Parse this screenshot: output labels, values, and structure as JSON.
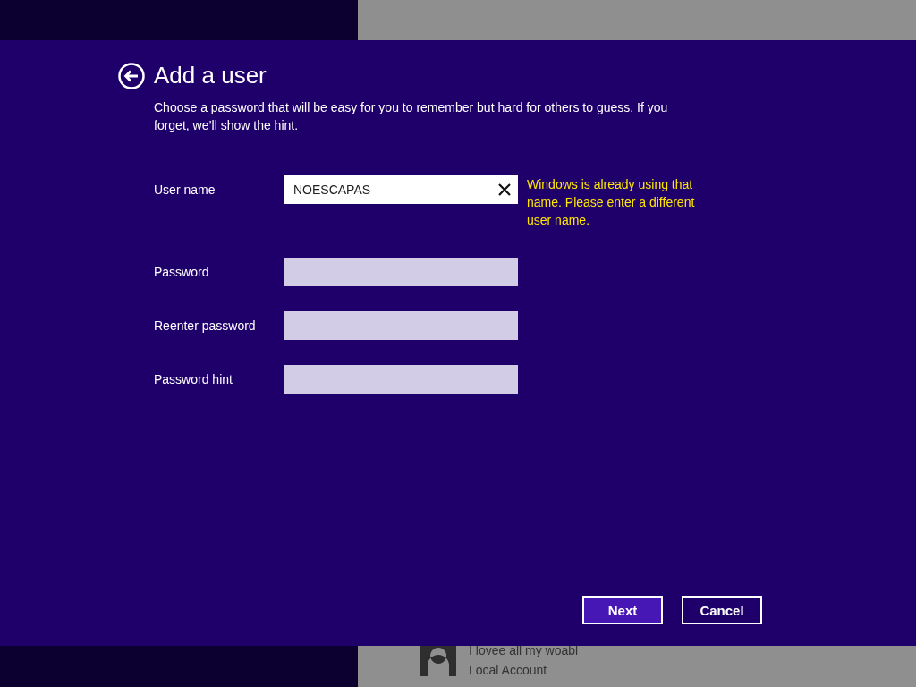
{
  "dialog": {
    "title": "Add a user",
    "description": "Choose a password that will be easy for you to remember but hard for others to guess. If you forget, we’ll show the hint.",
    "fields": [
      {
        "label": "User name",
        "value": "NOESCAPAS",
        "focused": true,
        "error": "Windows is already using that name. Please enter a different user name."
      },
      {
        "label": "Password",
        "focused": false
      },
      {
        "label": "Reenter password",
        "focused": false
      },
      {
        "label": "Password hint",
        "focused": false
      }
    ],
    "buttons": [
      {
        "label": "Next",
        "kind": "primary"
      },
      {
        "label": "Cancel",
        "kind": "secondary"
      }
    ]
  },
  "background_account": {
    "name": "I lovee all my woabl",
    "type": "Local Account"
  }
}
